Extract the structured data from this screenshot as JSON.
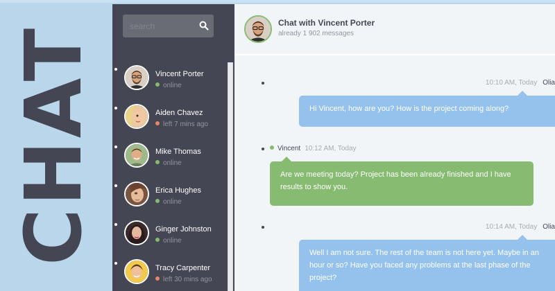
{
  "brand": {
    "word": "CHAT"
  },
  "search": {
    "placeholder": "search"
  },
  "contacts": [
    {
      "name": "Vincent Porter",
      "status": "online",
      "state": "online"
    },
    {
      "name": "Aiden Chavez",
      "status": "left 7 mins ago",
      "state": "away"
    },
    {
      "name": "Mike Thomas",
      "status": "online",
      "state": "online"
    },
    {
      "name": "Erica Hughes",
      "status": "online",
      "state": "online"
    },
    {
      "name": "Ginger Johnston",
      "status": "online",
      "state": "online"
    },
    {
      "name": "Tracy Carpenter",
      "status": "left 30 mins ago",
      "state": "away"
    }
  ],
  "chat": {
    "title": "Chat with Vincent Porter",
    "subtitle": "already 1 902 messages"
  },
  "messages": [
    {
      "time": "10:10 AM, Today",
      "author": "Olia",
      "text": "Hi Vincent, how are you? How is the project coming along?"
    },
    {
      "time": "10:12 AM, Today",
      "author": "Vincent",
      "text": "Are we meeting today? Project has been already finished and I have results to show you."
    },
    {
      "time": "10:14 AM, Today",
      "author": "Olia",
      "text": "Well I am not sure. The rest of the team is not here yet. Maybe in an hour or so? Have you faced any problems at the last phase of the project?"
    }
  ],
  "colors": {
    "sidebar": "#444753",
    "online": "#86bb71",
    "away": "#e38968",
    "bubble_out": "#94c2ed",
    "bubble_in": "#86bb71",
    "background": "#b9d6ea"
  },
  "icons": {
    "search": "search-icon",
    "avatar": "avatar"
  }
}
